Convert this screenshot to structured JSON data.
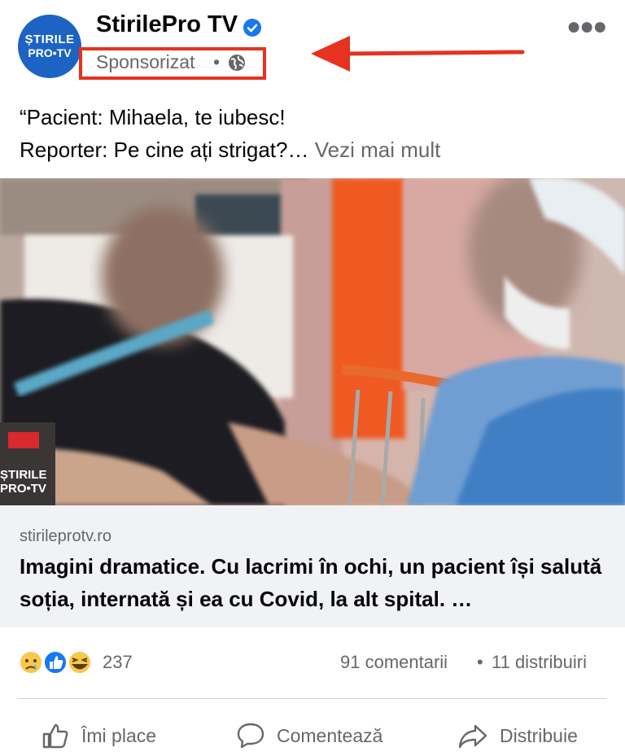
{
  "post": {
    "page_name": "StirilePro TV",
    "avatar_line1": "ȘTIRILE",
    "avatar_line2": "PRO•TV",
    "sponsored": "Sponsorizat",
    "separator": "•",
    "caption_line1": "“Pacient: Mihaela, te iubesc!",
    "caption_line2": "Reporter: Pe cine ați strigat?…",
    "see_more": "Vezi mai mult",
    "watermark_line1": "ȘTIRILE",
    "watermark_line2": "PRO•TV"
  },
  "link": {
    "domain": "stirileprotv.ro",
    "headline": "Imagini dramatice. Cu lacrimi în ochi, un pacient își salută soția, internată și ea cu Covid, la alt spital. …"
  },
  "stats": {
    "reaction_count": "237",
    "comments": "91 comentarii",
    "separator": "•",
    "shares": "11 distribuiri"
  },
  "actions": {
    "like": "Îmi place",
    "comment": "Comentează",
    "share": "Distribuie"
  },
  "colors": {
    "brand_blue": "#1877f2",
    "annotation_red": "#e6321f",
    "secondary_text": "#65676b"
  },
  "icons": [
    "verified-badge-icon",
    "globe-icon",
    "more-options-icon",
    "annotation-arrow-icon",
    "sad-reaction-icon",
    "like-reaction-icon",
    "haha-reaction-icon",
    "thumbs-up-icon",
    "comment-bubble-icon",
    "share-arrow-icon"
  ]
}
